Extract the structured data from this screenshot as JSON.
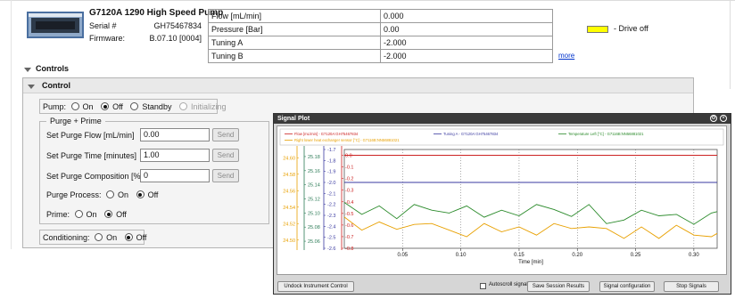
{
  "header": {
    "title": "G7120A 1290 High Speed Pump",
    "serial_label": "Serial #",
    "serial_value": "GH75467834",
    "firmware_label": "Firmware:",
    "firmware_value": "B.07.10 [0004]",
    "params": [
      {
        "label": "Flow [mL/min]",
        "value": "0.000"
      },
      {
        "label": "Pressure [Bar]",
        "value": "0.00"
      },
      {
        "label": "Tuning A",
        "value": "-2.000"
      },
      {
        "label": "Tuning B",
        "value": "-2.000"
      }
    ],
    "more_link": "more",
    "status_legend": "- Drive off",
    "status_color": "#ffff00"
  },
  "controls": {
    "section_title": "Controls",
    "control_title": "Control",
    "pump_label": "Pump:",
    "pump_options": [
      "On",
      "Off",
      "Standby",
      "Initializing"
    ],
    "pump_selected": "Off",
    "purge_group_title": "Purge + Prime",
    "purge_rows": [
      {
        "label": "Set Purge Flow [mL/min]",
        "value": "0.00",
        "button": "Send"
      },
      {
        "label": "Set Purge Time [minutes]",
        "value": "1.00",
        "button": "Send"
      },
      {
        "label": "Set Purge Composition [%B]",
        "value": "0",
        "button": "Send"
      }
    ],
    "purge_process_label": "Purge Process:",
    "purge_process_options": [
      "On",
      "Off"
    ],
    "purge_process_selected": "Off",
    "prime_label": "Prime:",
    "prime_options": [
      "On",
      "Off"
    ],
    "prime_selected": "Off",
    "conditioning_label": "Conditioning:",
    "conditioning_options": [
      "On",
      "Off"
    ],
    "conditioning_selected": "Off"
  },
  "signal_plot": {
    "window_title": "Signal Plot",
    "undock_button": "Undock Instrument Control",
    "autoscroll_label": "Autoscroll signals",
    "save_button": "Save Session Results",
    "config_button": "Signal configuration",
    "stop_button": "Stop Signals",
    "icons": [
      "settings-icon",
      "close-icon"
    ]
  },
  "chart_data": {
    "type": "line",
    "xlabel": "Time [min]",
    "x_ticks": [
      "0.05",
      "0.10",
      "0.15",
      "0.20",
      "0.25",
      "0.30"
    ],
    "xlim": [
      0,
      0.32
    ],
    "axes": [
      {
        "name": "orange-axis",
        "color": "#e8a000",
        "ticks": [
          "24.60",
          "24.58",
          "24.56",
          "24.54",
          "24.52",
          "24.50"
        ],
        "range": [
          24.49,
          24.61
        ]
      },
      {
        "name": "teal-axis",
        "color": "#2a7a55",
        "ticks": [
          "25.18",
          "25.16",
          "25.14",
          "25.12",
          "25.10",
          "25.08",
          "25.06"
        ],
        "range": [
          25.05,
          25.19
        ]
      },
      {
        "name": "blue-axis",
        "color": "#3a3aa0",
        "ticks": [
          "-1.7",
          "-1.8",
          "-1.9",
          "-2.0",
          "-2.1",
          "-2.2",
          "-2.3",
          "-2.4",
          "-2.5",
          "-2.6"
        ],
        "range": [
          -2.6,
          -1.7
        ]
      },
      {
        "name": "red-axis",
        "color": "#cc2222",
        "ticks": [
          "0.0",
          "-0.1",
          "-0.2",
          "-0.3",
          "-0.4",
          "-0.5",
          "-0.6",
          "-0.7",
          "-0.8"
        ],
        "range": [
          -0.8,
          0.05
        ]
      }
    ],
    "legend": [
      {
        "name": "Flow [mL/min] - G7120A:GH75467834",
        "color": "#cc2222"
      },
      {
        "name": "Tuning A - G7120A:GH75467834",
        "color": "#3a3aa0"
      },
      {
        "name": "Temperature Left [°C] - G7116B:NN56881021",
        "color": "#2a8a2a"
      },
      {
        "name": "Right lower heat exchanger sensor [°C] - G7116B:NN56881021",
        "color": "#e8a000"
      }
    ],
    "series": [
      {
        "name": "Flow [mL/min]",
        "color": "#cc2222",
        "x": [
          0.0,
          0.32
        ],
        "y": [
          0.0,
          0.0
        ],
        "axis": 3
      },
      {
        "name": "Tuning A",
        "color": "#3a3aa0",
        "x": [
          0.0,
          0.32
        ],
        "y": [
          -2.0,
          -2.0
        ],
        "axis": 2
      },
      {
        "name": "Temperature Left [°C]",
        "color": "#2a8a2a",
        "x": [
          0.0,
          0.015,
          0.03,
          0.045,
          0.06,
          0.075,
          0.09,
          0.105,
          0.12,
          0.135,
          0.15,
          0.165,
          0.18,
          0.195,
          0.21,
          0.225,
          0.24,
          0.255,
          0.27,
          0.285,
          0.3,
          0.315,
          0.32
        ],
        "y": [
          25.115,
          25.098,
          25.11,
          25.092,
          25.112,
          25.104,
          25.1,
          25.11,
          25.094,
          25.104,
          25.096,
          25.112,
          25.105,
          25.095,
          25.112,
          25.085,
          25.09,
          25.104,
          25.096,
          25.098,
          25.084,
          25.1,
          25.102
        ],
        "axis": 1
      },
      {
        "name": "Right lower heat exchanger sensor [°C]",
        "color": "#e8a000",
        "x": [
          0.0,
          0.015,
          0.03,
          0.045,
          0.06,
          0.075,
          0.09,
          0.105,
          0.12,
          0.135,
          0.15,
          0.165,
          0.18,
          0.195,
          0.21,
          0.225,
          0.24,
          0.255,
          0.27,
          0.285,
          0.3,
          0.315,
          0.32
        ],
        "y": [
          24.528,
          24.512,
          24.522,
          24.513,
          24.519,
          24.52,
          24.512,
          24.504,
          24.52,
          24.51,
          24.516,
          24.506,
          24.52,
          24.514,
          24.516,
          24.514,
          24.502,
          24.516,
          24.502,
          24.518,
          24.506,
          24.504,
          24.508
        ],
        "axis": 0
      }
    ],
    "grid": "vertical-dotted"
  }
}
